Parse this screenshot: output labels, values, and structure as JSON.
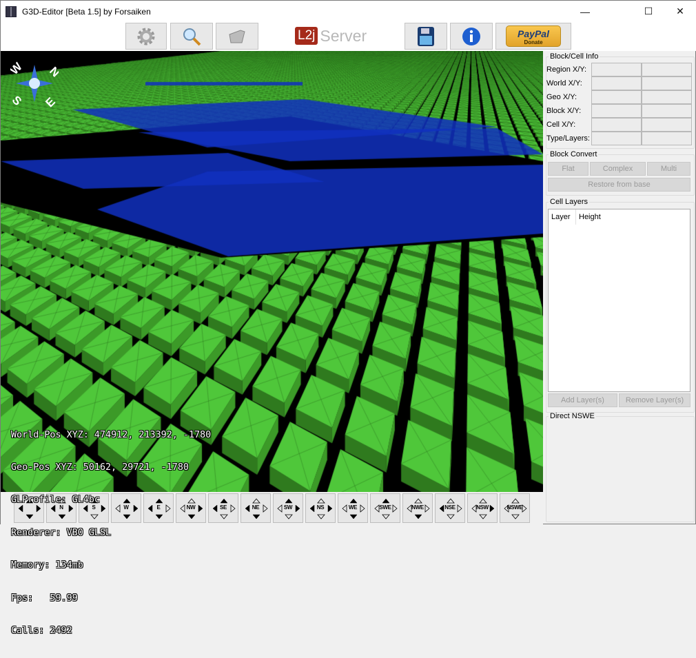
{
  "window": {
    "title": "G3D-Editor [Beta 1.5] by Forsaiken",
    "minimize": "—",
    "maximize": "☐",
    "close": "✕"
  },
  "toolbar": {
    "left_buttons": [
      {
        "icon": "gear-icon"
      },
      {
        "icon": "magnifier-icon"
      },
      {
        "icon": "folder-icon"
      }
    ],
    "logo": {
      "l2j": "L2j",
      "server": "Server"
    },
    "right_buttons": [
      {
        "icon": "floppy-save-icon"
      },
      {
        "icon": "info-icon"
      }
    ],
    "paypal": {
      "brand": "PayPal",
      "donate": "Donate"
    }
  },
  "viewport": {
    "compass": {
      "n": "N",
      "s": "S",
      "w": "W",
      "e": "E"
    },
    "stats": [
      "World-Pos XYZ: 474912, 213392, -1780",
      "Geo-Pos XYZ: 50162, 29721, -1780",
      "GLProfile: GL4bc",
      "Renderer: VBO GLSL",
      "Memory: 134mb",
      "Fps:   59.99",
      "Calls: 2492"
    ],
    "colors": {
      "tile": "#4fc73a",
      "plane": "#1030c0",
      "background": "#000000"
    }
  },
  "nswe_buttons": [
    "",
    "N",
    "S",
    "W",
    "E",
    "NW",
    "SE",
    "NE",
    "SW",
    "NS",
    "WE",
    "SWE",
    "NWE",
    "NSE",
    "NSW",
    "NSWE"
  ],
  "panel": {
    "block_cell_info": {
      "title": "Block/Cell Info",
      "rows": [
        "Region X/Y:",
        "World X/Y:",
        "Geo X/Y:",
        "Block X/Y:",
        "Cell X/Y:",
        "Type/Layers:"
      ]
    },
    "block_convert": {
      "title": "Block Convert",
      "flat": "Flat",
      "complex": "Complex",
      "multi": "Multi",
      "restore": "Restore from base"
    },
    "cell_layers": {
      "title": "Cell Layers",
      "columns": [
        "Layer",
        "Height"
      ],
      "add": "Add Layer(s)",
      "remove": "Remove Layer(s)"
    },
    "direct_nswe": {
      "title": "Direct NSWE"
    }
  }
}
